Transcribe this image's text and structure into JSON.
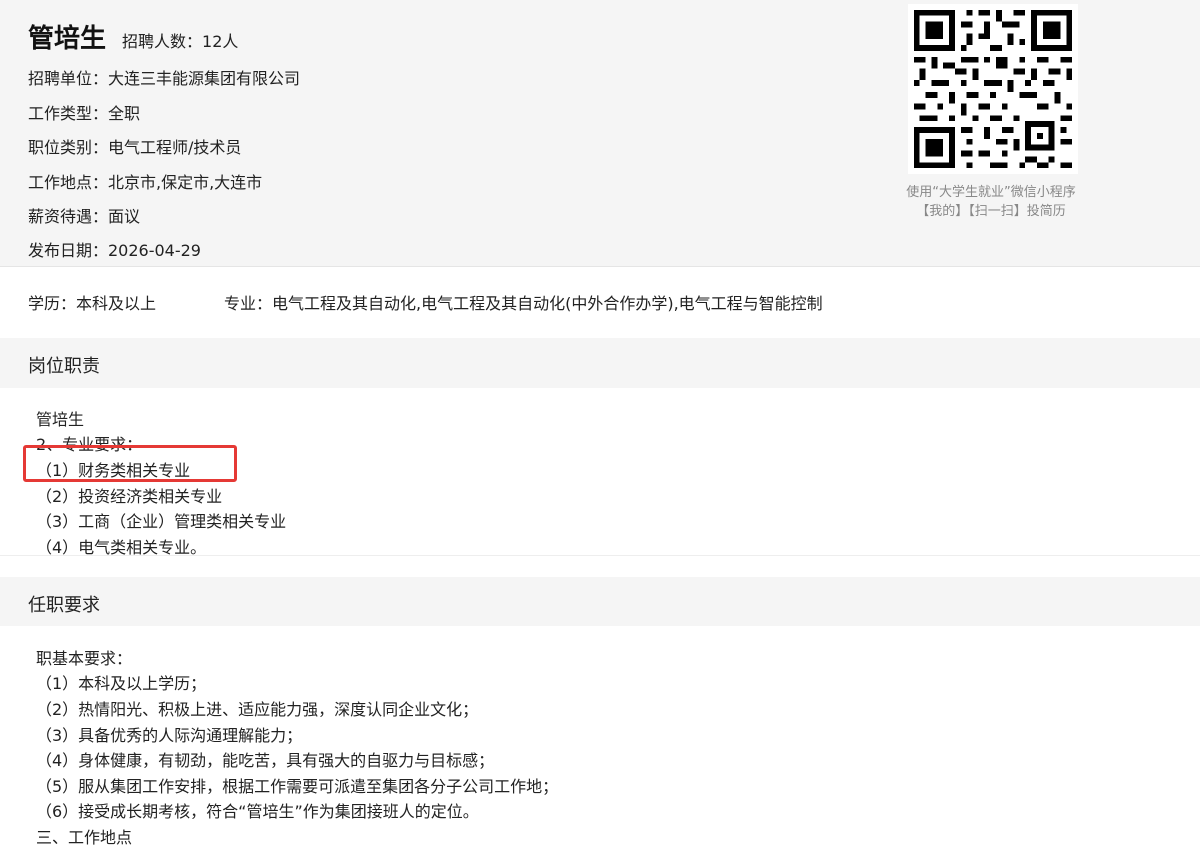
{
  "job": {
    "title": "管培生",
    "headcount": "招聘人数：12人"
  },
  "info": {
    "company": "招聘单位：大连三丰能源集团有限公司",
    "type": "工作类型：全职",
    "category": "职位类别：电气工程师/技术员",
    "location": "工作地点：北京市,保定市,大连市",
    "salary": "薪资待遇：面议",
    "date": "发布日期：2026-04-29"
  },
  "qr": {
    "caption_line1": "使用“大学生就业”微信小程序",
    "caption_line2": "【我的】【扫一扫】投简历"
  },
  "requirements_row": {
    "education": "学历：本科及以上",
    "major": "专业：电气工程及其自动化,电气工程及其自动化(中外合作办学),电气工程与智能控制"
  },
  "duties": {
    "heading": "岗位职责",
    "lines": [
      "管培生",
      "2、专业要求：",
      "（1）财务类相关专业",
      "（2）投资经济类相关专业",
      "（3）工商（企业）管理类相关专业",
      "（4）电气类相关专业。"
    ]
  },
  "qualifications": {
    "heading": "任职要求",
    "lines": [
      "职基本要求：",
      "（1）本科及以上学历；",
      "（2）热情阳光、积极上进、适应能力强，深度认同企业文化；",
      "（3）具备优秀的人际沟通理解能力；",
      "（4）身体健康，有韧劲，能吃苦，具有强大的自驱力与目标感；",
      "（5）服从集团工作安排，根据工作需要可派遣至集团各分子公司工作地；",
      "（6）接受成长期考核，符合“管培生”作为集团接班人的定位。",
      "三、工作地点"
    ]
  },
  "colors": {
    "highlight": "#e53935",
    "header_bg": "#f5f5f5"
  }
}
